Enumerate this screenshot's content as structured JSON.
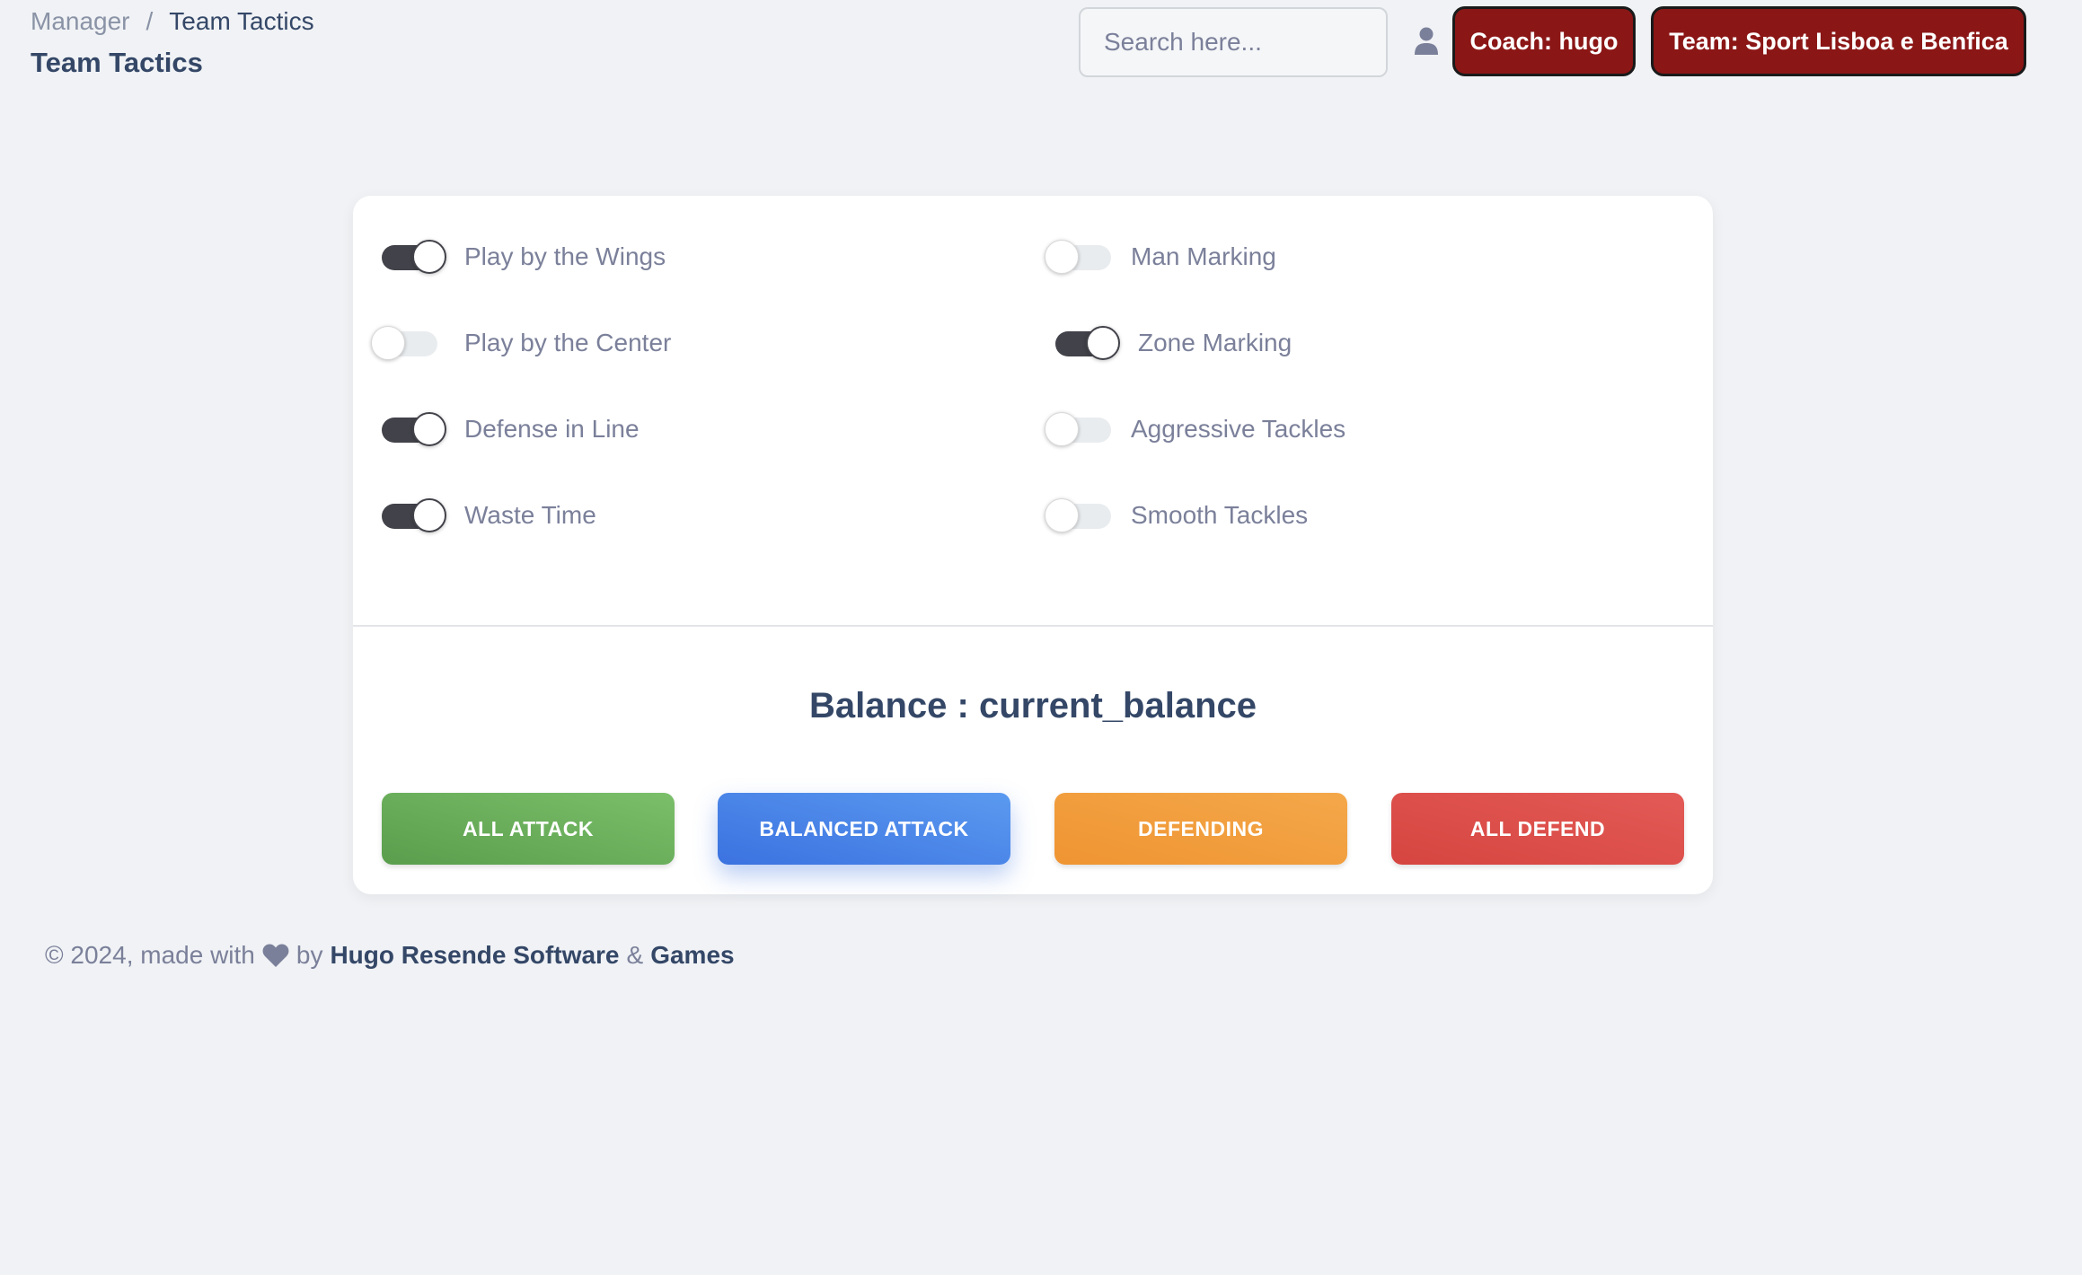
{
  "breadcrumb": {
    "root": "Manager",
    "separator": "/",
    "current": "Team Tactics"
  },
  "page_title": "Team Tactics",
  "search": {
    "placeholder": "Search here..."
  },
  "header": {
    "user_icon": "user-icon",
    "coach_label": "Coach: hugo",
    "team_label": "Team: Sport Lisboa e Benfica",
    "button_color": "#8b1616"
  },
  "toggles": {
    "left": [
      {
        "label": "Play by the Wings",
        "on": true
      },
      {
        "label": "Play by the Center",
        "on": false
      },
      {
        "label": "Defense in Line",
        "on": true
      },
      {
        "label": "Waste Time",
        "on": true
      }
    ],
    "right": [
      {
        "label": "Man Marking",
        "on": false
      },
      {
        "label": "Zone Marking",
        "on": true
      },
      {
        "label": "Aggressive Tackles",
        "on": false
      },
      {
        "label": "Smooth Tackles",
        "on": false
      }
    ]
  },
  "balance": {
    "text": "Balance : current_balance"
  },
  "actions": {
    "all_attack": "ALL ATTACK",
    "balanced_attack": "BALANCED ATTACK",
    "defending": "DEFENDING",
    "all_defend": "ALL DEFEND"
  },
  "colors": {
    "attack": "#6aaf5b",
    "balanced": "#4a86e8",
    "defending": "#f19e3d",
    "defend": "#dc4f4a"
  },
  "footer": {
    "prefix": "© 2024, made with",
    "heart_icon": "heart-icon",
    "by": "by",
    "author": "Hugo Resende Software",
    "amp": "&",
    "games": "Games"
  }
}
